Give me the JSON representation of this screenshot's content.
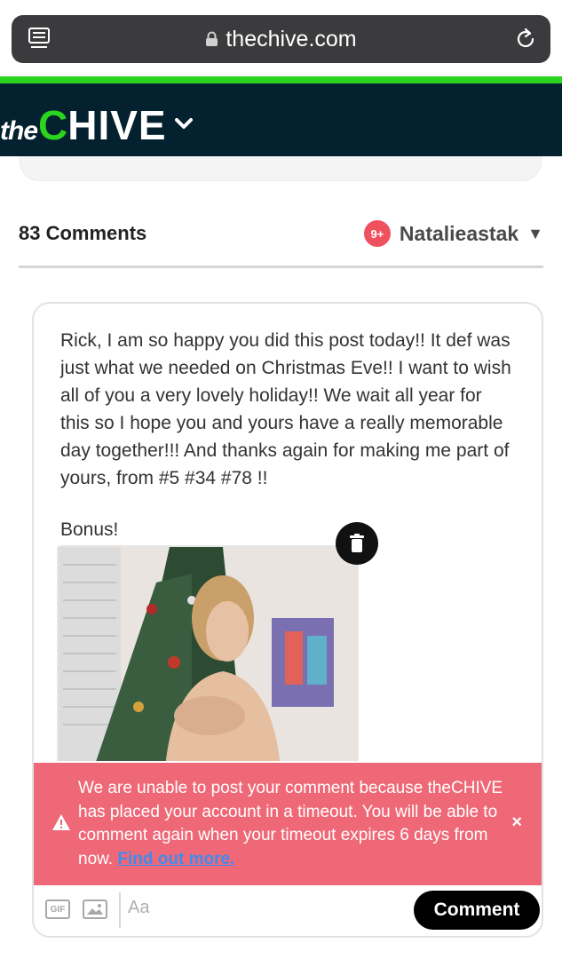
{
  "browser": {
    "url": "thechive.com",
    "reader_icon": "reader-mode-icon",
    "lock_icon": "lock-icon",
    "reload_icon": "reload-icon"
  },
  "header": {
    "logo_prefix": "the",
    "logo_c": "C",
    "logo_rest": "HIVE",
    "menu_icon": "chevron-down-icon",
    "brand_green": "#2ad41f",
    "brand_navy": "#03212e"
  },
  "comments": {
    "count_label": "83 Comments",
    "notification_badge": "9+",
    "username": "Natalieastak",
    "caret": "▼"
  },
  "composer": {
    "text": "Rick, I am so happy you did this post today!! It def was just what we needed on Christmas Eve!! I want to wish all of you a very lovely holiday!! We wait all year for this so I hope you and yours have a really memorable day together!!! And thanks again for making me part of yours, from #5 #34 #78 !!",
    "bonus": "Bonus!",
    "attachment_icon": "attached-photo",
    "delete_icon": "trash-icon"
  },
  "error": {
    "message": "We are unable to post your comment because theCHIVE has placed your account in a timeout. You will be able to comment again when your timeout expires 6 days from now.",
    "link_text": "Find out more.",
    "close": "×",
    "warning_icon": "warning-icon",
    "bg_color": "#ef6877"
  },
  "toolbar": {
    "gif_label": "GIF",
    "image_icon": "image-icon",
    "placeholder": "Aa",
    "submit_label": "Comment"
  }
}
